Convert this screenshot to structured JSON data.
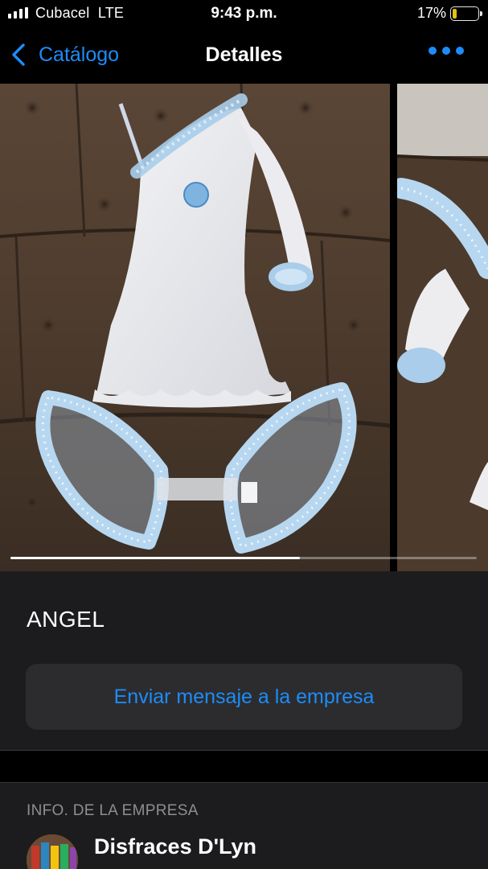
{
  "status_bar": {
    "carrier": "Cubacel  LTE",
    "time": "9:43 p.m.",
    "battery_percent": "17%",
    "battery_level": 0.17,
    "battery_color": "#ffd60a"
  },
  "nav": {
    "back_label": "Catálogo",
    "back_icon": "chevron-left-icon",
    "title": "Detalles",
    "more_icon": "ellipsis-icon"
  },
  "gallery": {
    "photo_index_progress": 0.62,
    "photos": [
      "angel-costume-dress-and-wings",
      "angel-costume-detail"
    ]
  },
  "product": {
    "name": "ANGEL",
    "message_button": "Enviar mensaje a la empresa"
  },
  "company": {
    "section_header": "INFO. DE LA EMPRESA",
    "name": "Disfraces D'Lyn"
  },
  "colors": {
    "accent": "#1d8cf8",
    "background": "#000000",
    "card": "#1c1c1e",
    "button": "#2c2c2e"
  }
}
